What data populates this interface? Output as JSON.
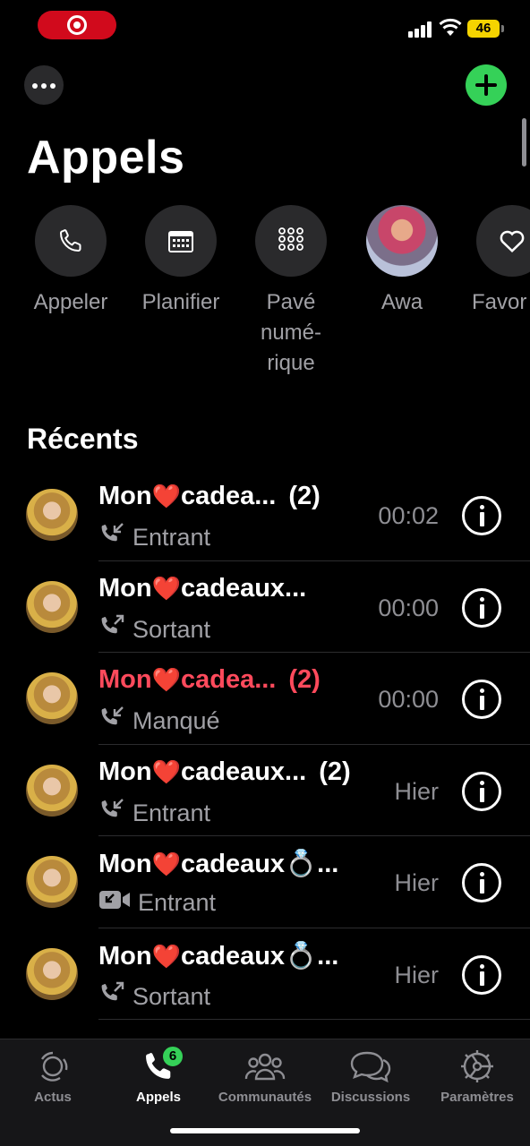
{
  "status_bar": {
    "battery": "46"
  },
  "header": {
    "title": "Appels"
  },
  "quick_actions": [
    {
      "label": "Appeler",
      "icon": "phone-icon"
    },
    {
      "label": "Planifier",
      "icon": "calendar-icon"
    },
    {
      "label": "Pavé numé-rique",
      "icon": "keypad-icon"
    },
    {
      "label": "Awa",
      "icon": "avatar"
    },
    {
      "label": "Favor",
      "icon": "heart-icon"
    }
  ],
  "recents": {
    "title": "Récents",
    "items": [
      {
        "name": "Mon",
        "name_rest": "cadea...",
        "count": "(2)",
        "type": "Entrant",
        "direction": "incoming",
        "time": "00:02",
        "missed": false
      },
      {
        "name": "Mon",
        "name_rest": "cadeaux...",
        "count": "",
        "type": "Sortant",
        "direction": "outgoing",
        "time": "00:00",
        "missed": false
      },
      {
        "name": "Mon",
        "name_rest": "cadea...",
        "count": "(2)",
        "type": "Manqué",
        "direction": "incoming",
        "time": "00:00",
        "missed": true
      },
      {
        "name": "Mon",
        "name_rest": "cadeaux...",
        "count": "(2)",
        "type": "Entrant",
        "direction": "incoming",
        "time": "Hier",
        "missed": false
      },
      {
        "name": "Mon",
        "name_rest": "cadeaux💍...",
        "count": "",
        "type": "Entrant",
        "direction": "video",
        "time": "Hier",
        "missed": false
      },
      {
        "name": "Mon",
        "name_rest": "cadeaux💍...",
        "count": "",
        "type": "Sortant",
        "direction": "outgoing",
        "time": "Hier",
        "missed": false
      }
    ]
  },
  "tab_bar": {
    "items": [
      {
        "label": "Actus",
        "icon": "updates-icon"
      },
      {
        "label": "Appels",
        "icon": "phone-icon",
        "badge": "6",
        "active": true
      },
      {
        "label": "Communautés",
        "icon": "communities-icon"
      },
      {
        "label": "Discussions",
        "icon": "chats-icon"
      },
      {
        "label": "Paramètres",
        "icon": "settings-icon"
      }
    ]
  },
  "colors": {
    "accent": "#35d158",
    "missed": "#ff4a5c",
    "background": "#000000"
  }
}
